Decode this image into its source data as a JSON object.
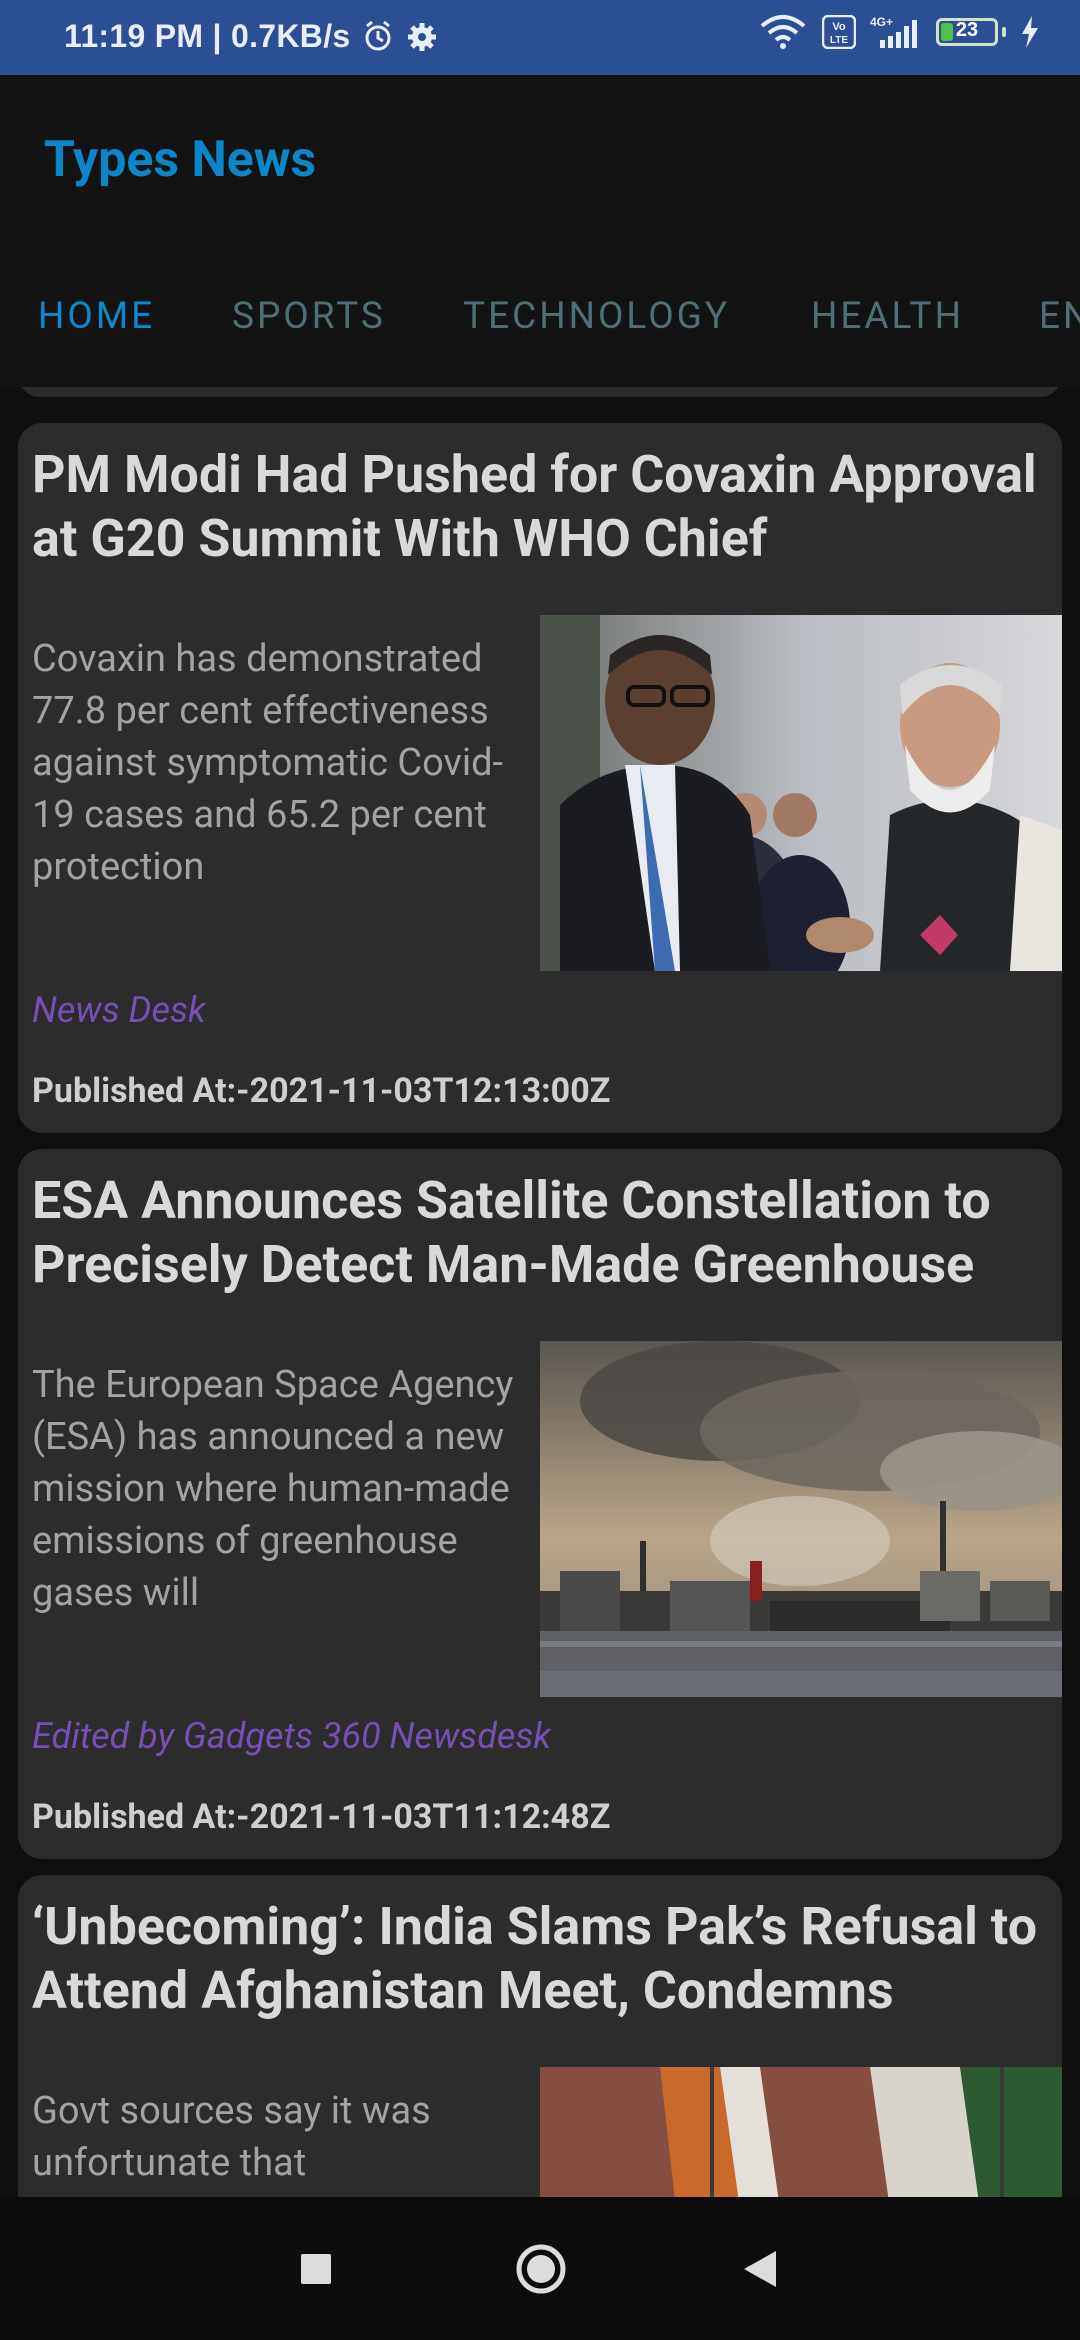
{
  "status_bar": {
    "time": "11:19 PM | 0.7KB/s",
    "battery_level": "23",
    "battery_fraction": 0.23,
    "icons": [
      "alarm-icon",
      "settings-icon",
      "wifi-icon",
      "volte-icon",
      "signal-icon",
      "battery-icon",
      "charging-icon"
    ],
    "volte_label": "Vo LTE",
    "network_label": "4G+"
  },
  "app": {
    "title": "Types News",
    "colors": {
      "accent": "#0d88ca",
      "indicator": "#6b34b8",
      "author": "#7a4fb5"
    }
  },
  "tabs": [
    {
      "label": "HOME",
      "active": true
    },
    {
      "label": "SPORTS",
      "active": false
    },
    {
      "label": "TECHNOLOGY",
      "active": false
    },
    {
      "label": "HEALTH",
      "active": false
    },
    {
      "label": "EN",
      "active": false
    }
  ],
  "articles": [
    {
      "title": "PM Modi Had Pushed for Covaxin Approval at G20 Summit With WHO Chief",
      "description": "Covaxin has demonstrated 77.8 per cent effectiveness against symptomatic Covid-19 cases and 65.2 per cent protection",
      "author": "News Desk",
      "published": "Published At:-2021-11-03T12:13:00Z",
      "image_icon": "photo-two-leaders-greeting"
    },
    {
      "title": "ESA Announces Satellite Constellation to Precisely Detect Man-Made Greenhouse",
      "description": "The European Space Agency (ESA) has announced a new mission where human-made emissions of greenhouse gases will",
      "author": "Edited by Gadgets 360 Newsdesk",
      "published": "Published At:-2021-11-03T11:12:48Z",
      "image_icon": "photo-industrial-smoke"
    },
    {
      "title": "‘Unbecoming’: India Slams Pak’s Refusal to Attend Afghanistan Meet, Condemns",
      "description": "Govt sources say it was unfortunate that",
      "author": "",
      "published": "",
      "image_icon": "photo-flags"
    }
  ],
  "nav_bar": {
    "buttons": [
      "recents-square-icon",
      "home-circle-icon",
      "back-triangle-icon"
    ]
  }
}
